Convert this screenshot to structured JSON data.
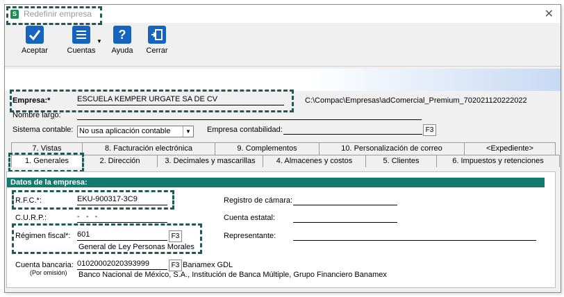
{
  "window": {
    "title": "Redefinir empresa",
    "app_icon": "S",
    "close_glyph": "✕"
  },
  "toolbar": {
    "accept": "Aceptar",
    "accounts": "Cuentas",
    "help": "Ayuda",
    "close": "Cerrar"
  },
  "company": {
    "empresa_label": "Empresa:*",
    "empresa_value": "ESCUELA KEMPER URGATE SA DE CV",
    "path": "C:\\Compac\\Empresas\\adComercial_Premium_702021120222022",
    "nombre_largo_label": "Nombre largo:",
    "sistema_label": "Sistema contable:",
    "sistema_value": "No usa aplicación contable",
    "empresa_contab_label": "Empresa contabilidad:",
    "f3": "F3"
  },
  "tabs_row1": [
    "7. Vistas",
    "8. Facturación electrónica",
    "9. Complementos",
    "10. Personalización de correo",
    "<Expediente>"
  ],
  "tabs_row2": [
    "1. Generales",
    "2. Dirección",
    "3. Decimales y mascarillas",
    "4. Almacenes y costos",
    "5. Clientes",
    "6. Impuestos y retenciones"
  ],
  "datos": {
    "section_title": "Datos de la empresa:",
    "rfc_label": "R.F.C.*:",
    "rfc_value": "EKU-900317-3C9",
    "curp_label": "C.U.R.P.:",
    "curp_value": "-   -   -",
    "regimen_label": "Régimen fiscal*:",
    "regimen_value": "601",
    "regimen_desc": "General de Ley Personas Morales",
    "cuenta_label": "Cuenta bancaria:",
    "cuenta_sub": "(Por omisión)",
    "cuenta_value": "01020002020393999",
    "banco_short": "Banamex GDL",
    "banco_full": "Banco Nacional de México, S.A., Institución de Banca Múltiple, Grupo Financiero Banamex",
    "registro_label": "Registro de cámara:",
    "estatal_label": "Cuenta estatal:",
    "representante_label": "Representante:"
  }
}
